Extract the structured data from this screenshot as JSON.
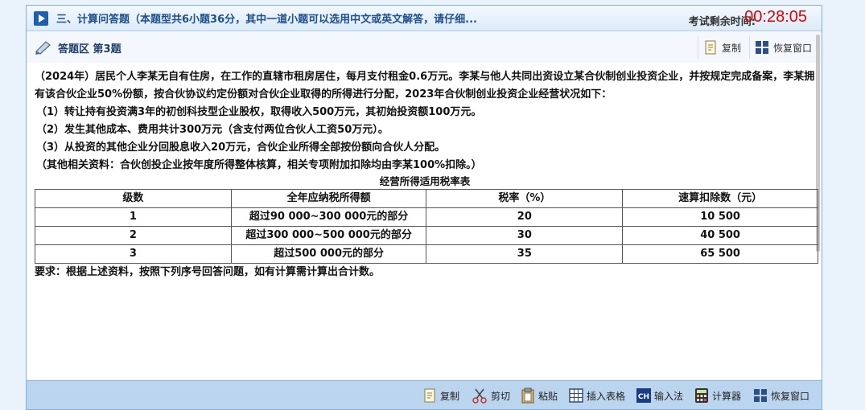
{
  "header": {
    "section_title": "三、计算问答题（本题型共6小题36分，其中一道小题可以选用中文或英文解答，请仔细...",
    "timer_label": "考试剩余时间:",
    "timer_value": "00:28:05"
  },
  "answer_area": {
    "title": "答题区 第3题",
    "copy_label": "复制",
    "restore_label": "恢复窗口"
  },
  "question": {
    "intro": "（2024年）居民个人李某无自有住房，在工作的直辖市租房居住，每月支付租金0.6万元。李某与他人共同出资设立某合伙制创业投资企业，并按规定完成备案，李某拥有该合伙企业50%份额，按合伙协议约定份额对合伙企业取得的所得进行分配，2023年合伙制创业投资企业经营状况如下：",
    "item1": "（1）转让持有投资满3年的初创科技型企业股权，取得收入500万元，其初始投资额100万元。",
    "item2": "（2）发生其他成本、费用共计300万元（含支付两位合伙人工资50万元）。",
    "item3": "（3）从投资的其他企业分回股息收入20万元，合伙企业所得全部按份额向合伙人分配。",
    "note": "（其他相关资料：合伙创投企业按年度所得整体核算，相关专项附加扣除均由李某100%扣除。）",
    "table_caption": "经营所得适用税率表",
    "table_headers": [
      "级数",
      "全年应纳税所得额",
      "税率（%）",
      "速算扣除数（元）"
    ],
    "table_rows": [
      [
        "1",
        "超过90 000~300 000元的部分",
        "20",
        "10 500"
      ],
      [
        "2",
        "超过300 000~500 000元的部分",
        "30",
        "40 500"
      ],
      [
        "3",
        "超过500 000元的部分",
        "35",
        "65 500"
      ]
    ],
    "requirement": "要求：根据上述资料，按照下列序号回答问题，如有计算需计算出合计数。"
  },
  "toolbar": {
    "copy": "复制",
    "cut": "剪切",
    "paste": "粘贴",
    "insert_table": "插入表格",
    "input_method": "输入法",
    "calculator": "计算器",
    "restore": "恢复窗口"
  },
  "colors": {
    "timer": "#e00000",
    "accent": "#1d4f8c",
    "toolbar_bg": "#bcd5ee"
  }
}
